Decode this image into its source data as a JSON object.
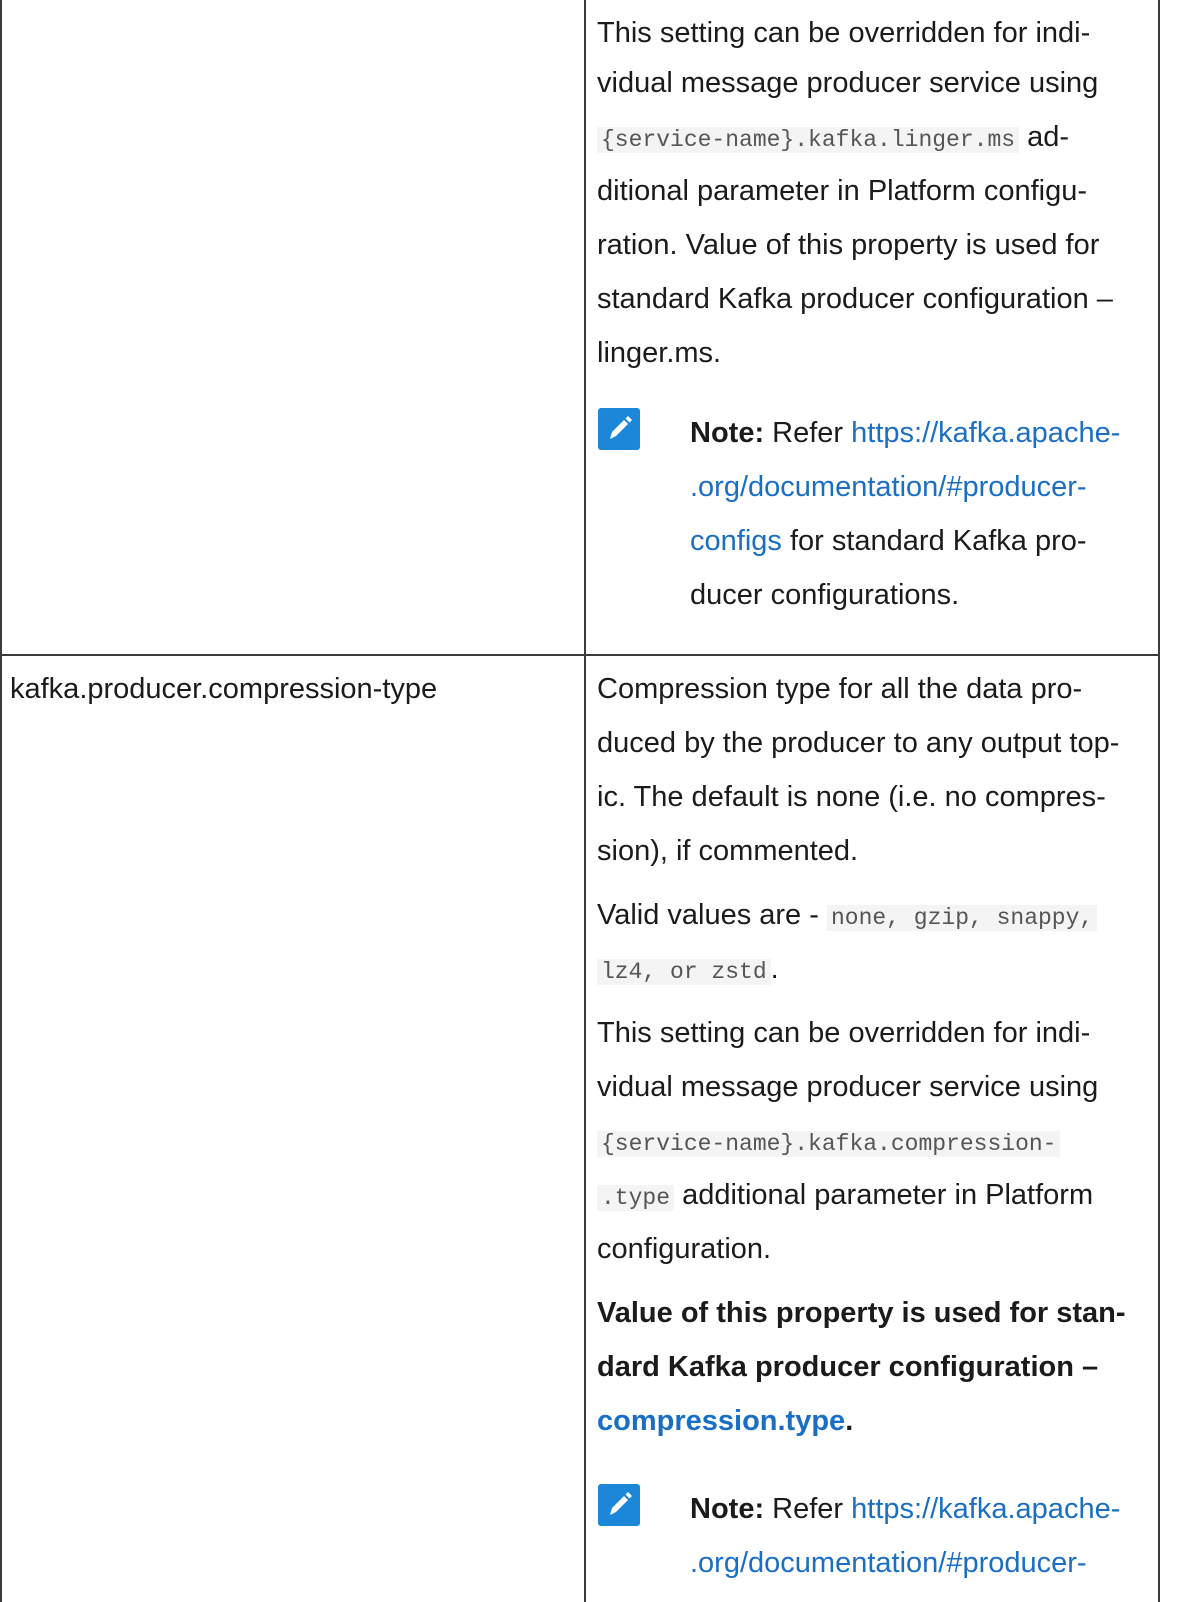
{
  "row1": {
    "desc_line1": "This setting can be overridden for indi-",
    "desc_line2": "vidual message producer service using",
    "code1": "{service-name}.kafka.linger.ms",
    "desc_line3_tail": " ad-",
    "desc_line4": "ditional parameter in Platform configu-",
    "desc_line5": "ration. Value of this property is used for",
    "desc_line6": "standard Kafka producer configuration –",
    "desc_line7": "linger.ms.",
    "note": {
      "icon": "pencil-icon",
      "label": "Note:",
      "refer": " Refer ",
      "link_line1": "https://kafka.apache-",
      "link_line2": ".org/documentation/#producer-",
      "link_line3": "configs",
      "tail_line3": " for standard Kafka pro-",
      "line4": "ducer configurations."
    }
  },
  "row2": {
    "property": "kafka.producer.compression-type",
    "p1_line1": "Compression type for all the data pro-",
    "p1_line2": "duced by the producer to any output top-",
    "p1_line3": "ic. The default is none (i.e. no compres-",
    "p1_line4": "sion), if commented.",
    "p2_prefix": "Valid values are - ",
    "p2_code1": "none, gzip, snappy,",
    "p2_code2": "lz4, or zstd",
    "p2_suffix": ".",
    "p3_line1": "This setting can be overridden for indi-",
    "p3_line2": "vidual message producer service using",
    "p3_code1": "{service-name}.kafka.compression-",
    "p3_code2": ".type",
    "p3_line4_tail": " additional parameter in Platform",
    "p3_line5": "configuration.",
    "p4_line1": "Value of this property is used for stan-",
    "p4_line2": "dard Kafka producer configuration –",
    "p4_link": "compression.type",
    "p4_suffix": ".",
    "note": {
      "icon": "pencil-icon",
      "label": "Note:",
      "refer": " Refer ",
      "link_line1": "https://kafka.apache-",
      "link_line2": ".org/documentation/#producer-"
    }
  }
}
